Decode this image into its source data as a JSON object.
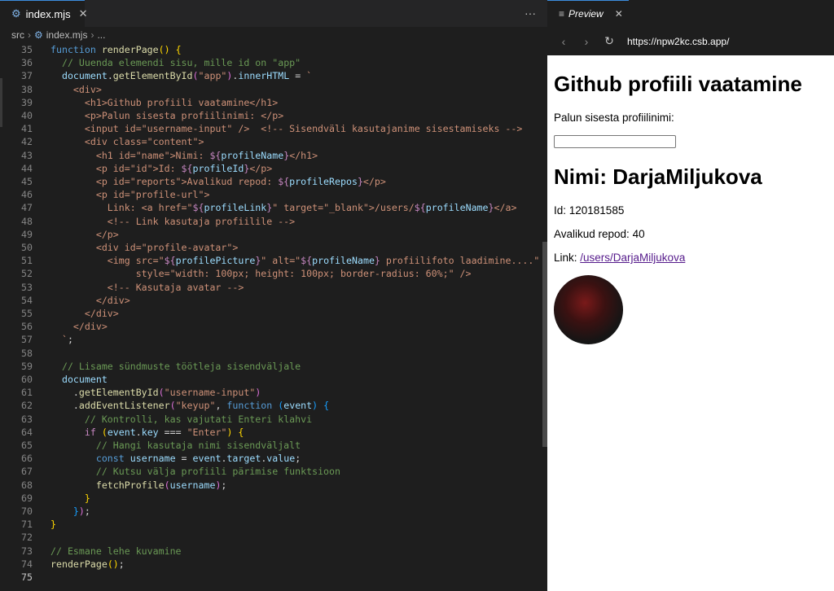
{
  "editor": {
    "tab_label": "index.mjs",
    "more_label": "···",
    "breadcrumb": [
      "src",
      "index.mjs",
      "..."
    ],
    "lines": [
      {
        "n": "35",
        "html": "<span class=\"kw\">function</span> <span class=\"fn\">renderPage</span><span class=\"yb\">()</span> <span class=\"yb\">{</span>"
      },
      {
        "n": "36",
        "html": "  <span class=\"cm\">// Uuenda elemendi sisu, mille id on \"app\"</span>"
      },
      {
        "n": "37",
        "html": "  <span class=\"var\">document</span>.<span class=\"fn\">getElementById</span><span class=\"pb\">(</span><span class=\"str\">\"app\"</span><span class=\"pb\">)</span>.<span class=\"var\">innerHTML</span> = <span class=\"str\">`</span>"
      },
      {
        "n": "38",
        "html": "<span class=\"str\">    &lt;div&gt;</span>"
      },
      {
        "n": "39",
        "html": "<span class=\"str\">      &lt;h1&gt;Github profiili vaatamine&lt;/h1&gt;</span>"
      },
      {
        "n": "40",
        "html": "<span class=\"str\">      &lt;p&gt;Palun sisesta profiilinimi: &lt;/p&gt;</span>"
      },
      {
        "n": "41",
        "html": "<span class=\"str\">      &lt;input id=\"username-input\" /&gt;  &lt;!-- Sisendväli kasutajanime sisestamiseks --&gt;</span>"
      },
      {
        "n": "42",
        "html": "<span class=\"str\">      &lt;div class=\"content\"&gt;</span>"
      },
      {
        "n": "43",
        "html": "<span class=\"str\">        &lt;h1 id=\"name\"&gt;Nimi: </span><span class=\"tmp\">${</span><span class=\"var\">profileName</span><span class=\"tmp\">}</span><span class=\"str\">&lt;/h1&gt;</span>"
      },
      {
        "n": "44",
        "html": "<span class=\"str\">        &lt;p id=\"id\"&gt;Id: </span><span class=\"tmp\">${</span><span class=\"var\">profileId</span><span class=\"tmp\">}</span><span class=\"str\">&lt;/p&gt;</span>"
      },
      {
        "n": "45",
        "html": "<span class=\"str\">        &lt;p id=\"reports\"&gt;Avalikud repod: </span><span class=\"tmp\">${</span><span class=\"var\">profileRepos</span><span class=\"tmp\">}</span><span class=\"str\">&lt;/p&gt;</span>"
      },
      {
        "n": "46",
        "html": "<span class=\"str\">        &lt;p id=\"profile-url\"&gt;</span>"
      },
      {
        "n": "47",
        "html": "<span class=\"str\">          Link: &lt;a href=\"</span><span class=\"tmp\">${</span><span class=\"var\">profileLink</span><span class=\"tmp\">}</span><span class=\"str\">\" target=\"_blank\"&gt;/users/</span><span class=\"tmp\">${</span><span class=\"var\">profileName</span><span class=\"tmp\">}</span><span class=\"str\">&lt;/a&gt;</span>"
      },
      {
        "n": "48",
        "html": "<span class=\"str\">          &lt;!-- Link kasutaja profiilile --&gt;</span>"
      },
      {
        "n": "49",
        "html": "<span class=\"str\">        &lt;/p&gt;</span>"
      },
      {
        "n": "50",
        "html": "<span class=\"str\">        &lt;div id=\"profile-avatar\"&gt;</span>"
      },
      {
        "n": "51",
        "html": "<span class=\"str\">          &lt;img src=\"</span><span class=\"tmp\">${</span><span class=\"var\">profilePicture</span><span class=\"tmp\">}</span><span class=\"str\">\" alt=\"</span><span class=\"tmp\">${</span><span class=\"var\">profileName</span><span class=\"tmp\">}</span><span class=\"str\"> profiilifoto laadimine....\"</span>"
      },
      {
        "n": "52",
        "html": "<span class=\"str\">               style=\"width: 100px; height: 100px; border-radius: 60%;\" /&gt;</span>"
      },
      {
        "n": "53",
        "html": "<span class=\"str\">          &lt;!-- Kasutaja avatar --&gt;</span>"
      },
      {
        "n": "54",
        "html": "<span class=\"str\">        &lt;/div&gt;</span>"
      },
      {
        "n": "55",
        "html": "<span class=\"str\">      &lt;/div&gt;</span>"
      },
      {
        "n": "56",
        "html": "<span class=\"str\">    &lt;/div&gt;</span>"
      },
      {
        "n": "57",
        "html": "<span class=\"str\">  `</span>;"
      },
      {
        "n": "58",
        "html": ""
      },
      {
        "n": "59",
        "html": "  <span class=\"cm\">// Lisame sündmuste töötleja sisendväljale</span>"
      },
      {
        "n": "60",
        "html": "  <span class=\"var\">document</span>"
      },
      {
        "n": "61",
        "html": "    .<span class=\"fn\">getElementById</span><span class=\"pb\">(</span><span class=\"str\">\"username-input\"</span><span class=\"pb\">)</span>"
      },
      {
        "n": "62",
        "html": "    .<span class=\"fn\">addEventListener</span><span class=\"pb\">(</span><span class=\"str\">\"keyup\"</span>, <span class=\"kw\">function</span> <span class=\"bb\">(</span><span class=\"var\">event</span><span class=\"bb\">)</span> <span class=\"bb\">{</span>"
      },
      {
        "n": "63",
        "html": "      <span class=\"cm\">// Kontrolli, kas vajutati Enteri klahvi</span>"
      },
      {
        "n": "64",
        "html": "      <span class=\"ctl\">if</span> <span class=\"yb\">(</span><span class=\"var\">event</span>.<span class=\"var\">key</span> === <span class=\"str\">\"Enter\"</span><span class=\"yb\">)</span> <span class=\"yb\">{</span>"
      },
      {
        "n": "65",
        "html": "        <span class=\"cm\">// Hangi kasutaja nimi sisendväljalt</span>"
      },
      {
        "n": "66",
        "html": "        <span class=\"kw\">const</span> <span class=\"var\">username</span> = <span class=\"var\">event</span>.<span class=\"var\">target</span>.<span class=\"var\">value</span>;"
      },
      {
        "n": "67",
        "html": "        <span class=\"cm\">// Kutsu välja profiili pärimise funktsioon</span>"
      },
      {
        "n": "68",
        "html": "        <span class=\"fn\">fetchProfile</span><span class=\"pb\">(</span><span class=\"var\">username</span><span class=\"pb\">)</span>;"
      },
      {
        "n": "69",
        "html": "      <span class=\"yb\">}</span>"
      },
      {
        "n": "70",
        "html": "    <span class=\"bb\">}</span><span class=\"pb\">)</span>;"
      },
      {
        "n": "71",
        "html": "<span class=\"yb\">}</span>"
      },
      {
        "n": "72",
        "html": ""
      },
      {
        "n": "73",
        "html": "<span class=\"cm\">// Esmane lehe kuvamine</span>"
      },
      {
        "n": "74",
        "html": "<span class=\"fn\">renderPage</span><span class=\"yb\">()</span>;"
      },
      {
        "n": "75",
        "html": ""
      }
    ]
  },
  "preview": {
    "tab_label": "Preview",
    "url": "https://npw2kc.csb.app/",
    "title": "Github profiili vaatamine",
    "prompt": "Palun sisesta profiilinimi:",
    "input_value": "",
    "name_heading": "Nimi: DarjaMiljukova",
    "id_text": "Id: 120181585",
    "repos_text": "Avalikud repod: 40",
    "link_prefix": "Link: ",
    "link_text": "/users/DarjaMiljukova"
  }
}
